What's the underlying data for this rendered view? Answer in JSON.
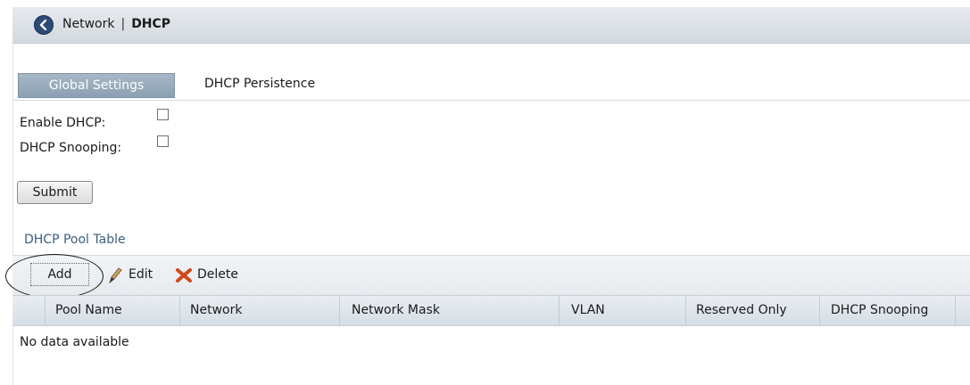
{
  "header": {
    "section": "Network",
    "separator": "|",
    "current": "DHCP"
  },
  "tabs": [
    {
      "label": "Global Settings",
      "active": true
    },
    {
      "label": "DHCP Persistence",
      "active": false
    }
  ],
  "form": {
    "enable_dhcp_label": "Enable DHCP:",
    "enable_dhcp_checked": false,
    "snooping_label": "DHCP Snooping:",
    "snooping_checked": false,
    "submit_label": "Submit"
  },
  "pool_table": {
    "title": "DHCP Pool Table",
    "toolbar": {
      "add": "Add",
      "edit": "Edit",
      "delete": "Delete"
    },
    "columns": [
      "Pool Name",
      "Network",
      "Network Mask",
      "VLAN",
      "Reserved Only",
      "DHCP Snooping"
    ],
    "empty_text": "No data available"
  },
  "colors": {
    "tab_active": "#97aabb",
    "title_text": "#3b5e80",
    "back_icon": "#2c4a75",
    "delete_icon": "#d04818"
  }
}
